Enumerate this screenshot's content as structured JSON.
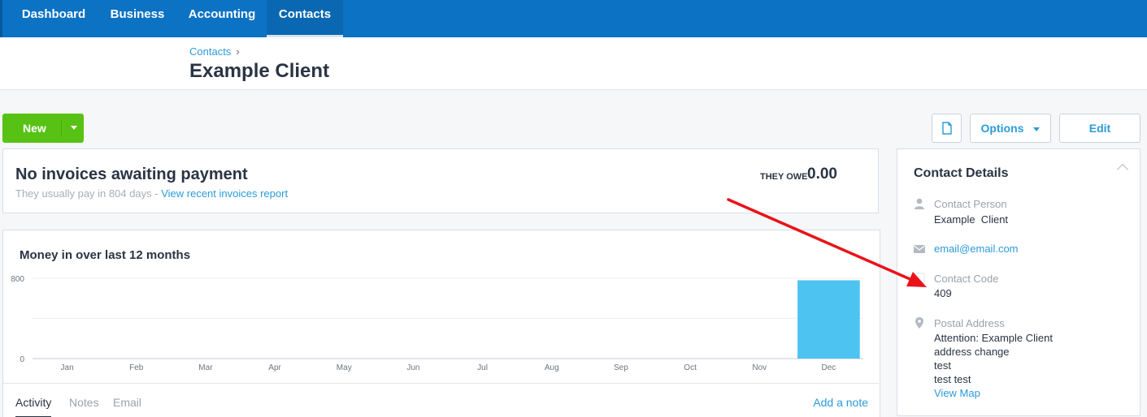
{
  "nav": {
    "items": [
      "Dashboard",
      "Business",
      "Accounting",
      "Contacts"
    ],
    "active": "Contacts"
  },
  "breadcrumb": {
    "parent": "Contacts",
    "sep": "›"
  },
  "page": {
    "title": "Example Client"
  },
  "toolbar": {
    "new_label": "New",
    "options_label": "Options",
    "edit_label": "Edit",
    "document_icon": "document-icon"
  },
  "invoices": {
    "title": "No invoices awaiting payment",
    "subtitle": "They usually pay in 804 days",
    "subtitle_sep": " - ",
    "report_link": "View recent invoices report",
    "owe_label": "THEY OWE",
    "owe_value": "0.00"
  },
  "chart_panel": {
    "title": "Money in over last 12 months"
  },
  "chart_data": {
    "type": "bar",
    "categories": [
      "Jan",
      "Feb",
      "Mar",
      "Apr",
      "May",
      "Jun",
      "Jul",
      "Aug",
      "Sep",
      "Oct",
      "Nov",
      "Dec"
    ],
    "values": [
      0,
      0,
      0,
      0,
      0,
      0,
      0,
      0,
      0,
      0,
      0,
      780
    ],
    "yticks": [
      "800",
      "0"
    ],
    "ylim": [
      0,
      800
    ],
    "grid": true,
    "bar_color": "#4dc3f2"
  },
  "tabs": {
    "items": [
      "Activity",
      "Notes",
      "Email"
    ],
    "active": "Activity",
    "add_note": "Add a note"
  },
  "contact_details": {
    "title": "Contact Details",
    "person_label": "Contact Person",
    "person_value": "Example  Client",
    "email": "email@email.com",
    "code_label": "Contact Code",
    "code_value": "409",
    "address_label": "Postal Address",
    "address_lines": [
      "Attention: Example Client",
      "address change",
      "test",
      "test test"
    ],
    "map_link": "View Map"
  },
  "colors": {
    "nav_bg": "#0b72c4",
    "accent_green": "#57c214",
    "link_blue": "#2a9bd8",
    "annotation_red": "#e8141a"
  }
}
